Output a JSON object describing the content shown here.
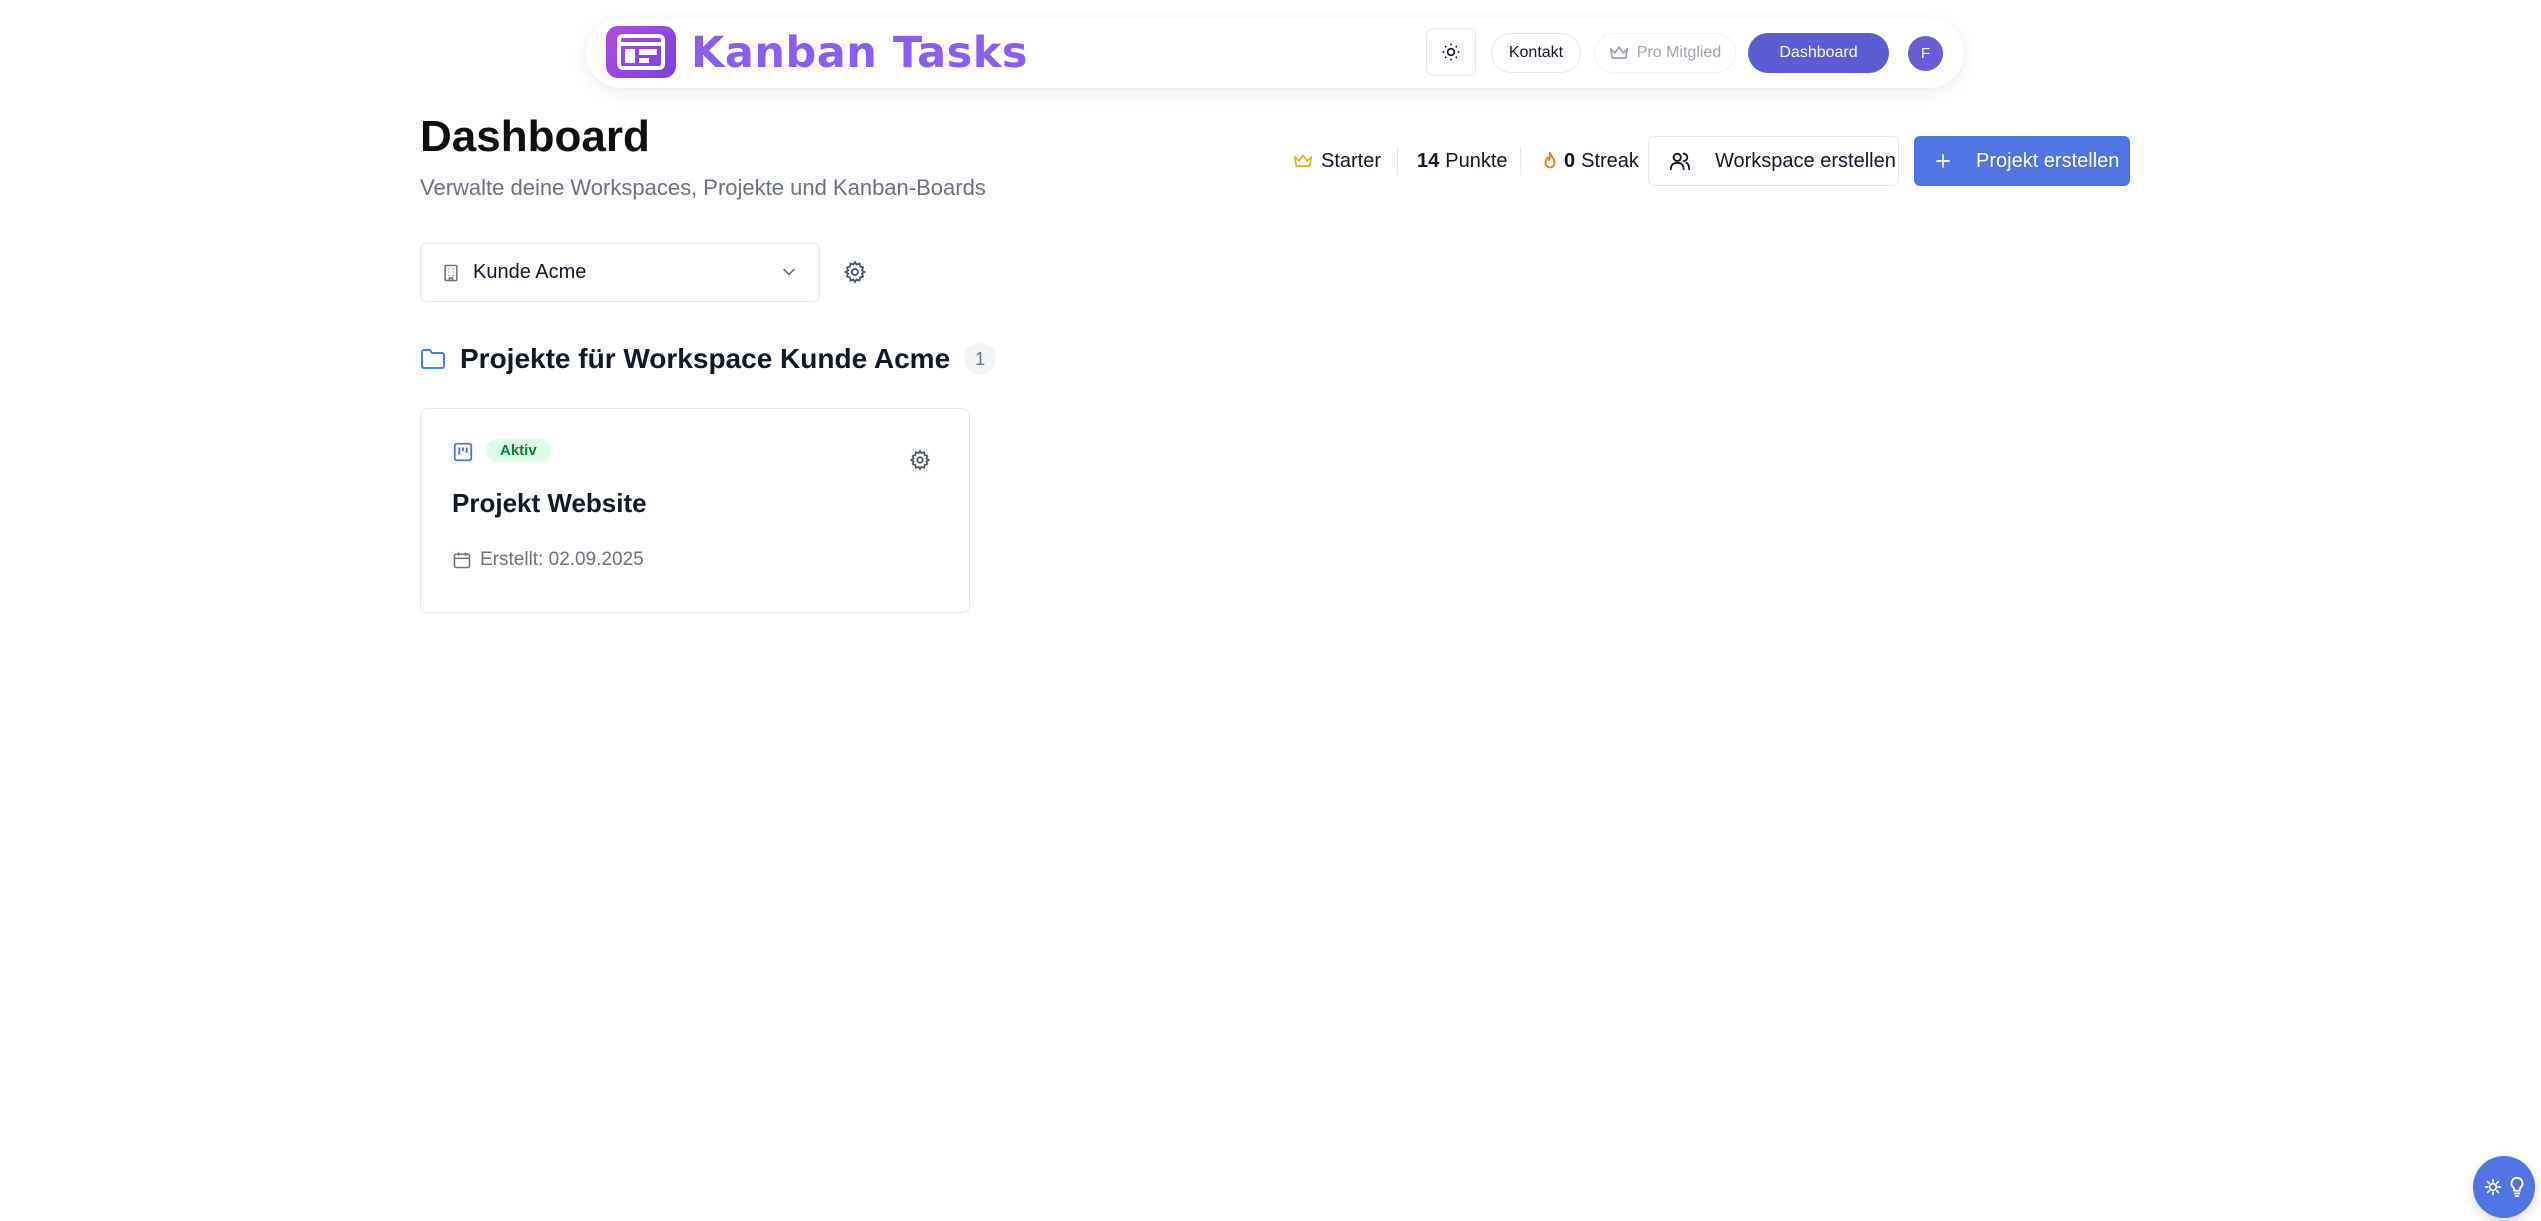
{
  "header": {
    "brand": "Kanban Tasks",
    "nav": {
      "kontakt": "Kontakt",
      "pro": "Pro Mitglied",
      "dashboard": "Dashboard"
    },
    "avatar_initial": "F"
  },
  "page": {
    "title": "Dashboard",
    "subtitle": "Verwalte deine Workspaces, Projekte und Kanban-Boards"
  },
  "stats": {
    "tier": "Starter",
    "points_value": "14",
    "points_label": "Punkte",
    "streak_value": "0",
    "streak_label": "Streak"
  },
  "actions": {
    "create_workspace": "Workspace erstellen",
    "create_project": "Projekt erstellen"
  },
  "workspace_select": {
    "selected": "Kunde Acme"
  },
  "section": {
    "title": "Projekte für Workspace Kunde Acme",
    "count": "1"
  },
  "projects": [
    {
      "status": "Aktiv",
      "name": "Projekt Website",
      "created": "Erstellt: 02.09.2025"
    }
  ],
  "colors": {
    "brand": "#8b5cf6",
    "primary": "#4f74e3",
    "nav_active": "#5b5bd6",
    "status_active_bg": "#dcfce7",
    "status_active_text": "#15803d"
  }
}
